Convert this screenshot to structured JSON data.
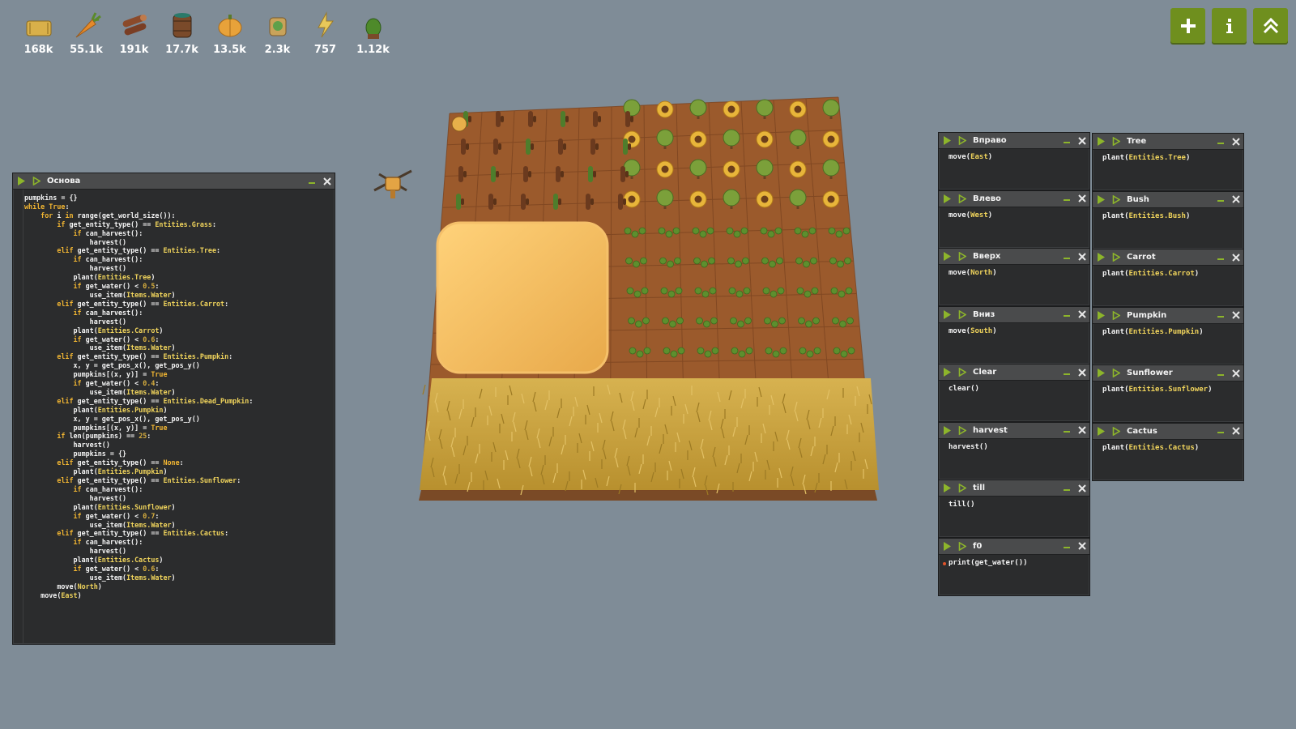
{
  "resources": [
    {
      "icon": "hay-icon",
      "amount": "168k"
    },
    {
      "icon": "carrot-icon",
      "amount": "55.1k"
    },
    {
      "icon": "wood-icon",
      "amount": "191k"
    },
    {
      "icon": "water-barrel-icon",
      "amount": "17.7k"
    },
    {
      "icon": "pumpkin-icon",
      "amount": "13.5k"
    },
    {
      "icon": "fertilizer-icon",
      "amount": "2.3k"
    },
    {
      "icon": "power-icon",
      "amount": "757"
    },
    {
      "icon": "cactus-icon",
      "amount": "1.12k"
    }
  ],
  "toolbar": {
    "add": "+",
    "info": "i",
    "up": "^"
  },
  "main_window": {
    "title": "Основа",
    "code": [
      "pumpkins = {}",
      "while True:",
      "    for i in range(get_world_size()):",
      "        if get_entity_type() == Entities.Grass:",
      "            if can_harvest():",
      "                harvest()",
      "        elif get_entity_type() == Entities.Tree:",
      "            if can_harvest():",
      "                harvest()",
      "            plant(Entities.Tree)",
      "            if get_water() < 0.5:",
      "                use_item(Items.Water)",
      "        elif get_entity_type() == Entities.Carrot:",
      "            if can_harvest():",
      "                harvest()",
      "            plant(Entities.Carrot)",
      "            if get_water() < 0.6:",
      "                use_item(Items.Water)",
      "        elif get_entity_type() == Entities.Pumpkin:",
      "            x, y = get_pos_x(), get_pos_y()",
      "            pumpkins[(x, y)] = True",
      "            if get_water() < 0.4:",
      "                use_item(Items.Water)",
      "        elif get_entity_type() == Entities.Dead_Pumpkin:",
      "            plant(Entities.Pumpkin)",
      "            x, y = get_pos_x(), get_pos_y()",
      "            pumpkins[(x, y)] = True",
      "        if len(pumpkins) == 25:",
      "            harvest()",
      "            pumpkins = {}",
      "        elif get_entity_type() == None:",
      "            plant(Entities.Pumpkin)",
      "        elif get_entity_type() == Entities.Sunflower:",
      "            if can_harvest():",
      "                harvest()",
      "            plant(Entities.Sunflower)",
      "            if get_water() < 0.7:",
      "                use_item(Items.Water)",
      "        elif get_entity_type() == Entities.Cactus:",
      "            if can_harvest():",
      "                harvest()",
      "            plant(Entities.Cactus)",
      "            if get_water() < 0.6:",
      "                use_item(Items.Water)",
      "        move(North)",
      "    move(East)"
    ]
  },
  "left_column": [
    {
      "title": "Вправо",
      "code": "move(East)"
    },
    {
      "title": "Влево",
      "code": "move(West)"
    },
    {
      "title": "Вверх",
      "code": "move(North)"
    },
    {
      "title": "Вниз",
      "code": "move(South)"
    },
    {
      "title": "Clear",
      "code": "clear()"
    },
    {
      "title": "harvest",
      "code": "harvest()"
    },
    {
      "title": "till",
      "code": "till()"
    },
    {
      "title": "f0",
      "code": "print(get_water())"
    }
  ],
  "right_column": [
    {
      "title": "Tree",
      "code": "plant(Entities.Tree)"
    },
    {
      "title": "Bush",
      "code": "plant(Entities.Bush)"
    },
    {
      "title": "Carrot",
      "code": "plant(Entities.Carrot)"
    },
    {
      "title": "Pumpkin",
      "code": "plant(Entities.Pumpkin)"
    },
    {
      "title": "Sunflower",
      "code": "plant(Entities.Sunflower)"
    },
    {
      "title": "Cactus",
      "code": "plant(Entities.Cactus)"
    }
  ],
  "colors": {
    "background": "#7f8c97",
    "window": "#2b2c2d",
    "window_header": "#4a4b4c",
    "accent_button": "#6f8f1e",
    "play_icon": "#8db52b",
    "soil": "#9c5a2a",
    "wheat": "#c9a23f",
    "pumpkin": "#f0b24d"
  }
}
